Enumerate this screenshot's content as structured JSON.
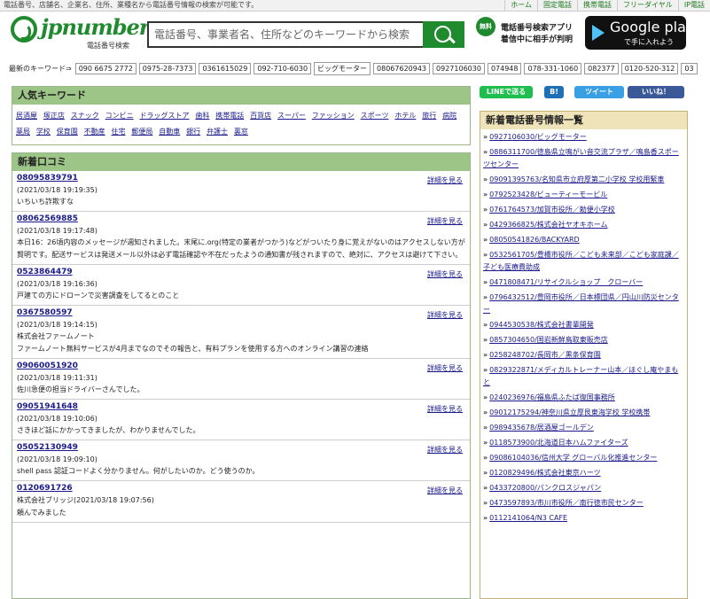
{
  "topbar": {
    "description": "電話番号、店舗名、企業名、住所、業種名から電話番号情報の検索が可能です。",
    "nav": [
      "ホーム",
      "固定電話",
      "携帯電話",
      "フリーダイヤル",
      "IP電話"
    ]
  },
  "header": {
    "logo_text": "jpnumber",
    "logo_sub": "電話番号検索",
    "search_placeholder": "電話番号、事業者名、住所などのキーワードから検索",
    "app_badge": "無料",
    "app_line1": "電話番号検索アプリ",
    "app_line2": "着信中に相手が判明",
    "gplay_line1": "Google play",
    "gplay_line2": "で手に入れよう"
  },
  "keywords": {
    "label": "最新のキーワード⇒",
    "items": [
      "090 6675 2772",
      "0975-28-7373",
      "0361615029",
      "092-710-6030",
      "ビッグモーター",
      "08067620943",
      "0927106030",
      "074948",
      "078-331-1060",
      "082377",
      "0120-520-312",
      "03"
    ]
  },
  "popular": {
    "title": "人気キーワード",
    "tags": [
      "居酒屋",
      "塚正店",
      "スナック",
      "コンビニ",
      "ドラッグストア",
      "歯科",
      "携帯電話",
      "百貨店",
      "スーパー",
      "ファッション",
      "スポーツ",
      "ホテル",
      "旅行",
      "病院",
      "薬局",
      "学校",
      "保育園",
      "不動産",
      "住宅",
      "郵便局",
      "自動車",
      "銀行",
      "弁護士",
      "裏窓"
    ]
  },
  "social": {
    "line": "LINEで送る",
    "hatena": "B!",
    "tweet": "ツイート",
    "like": "いいね！"
  },
  "reviews": {
    "title": "新着口コミ",
    "more_label": "詳細を見る",
    "items": [
      {
        "number": "08095839791",
        "date": "(2021/03/18 19:19:35)",
        "body": [
          "いちいち詐欺すな"
        ]
      },
      {
        "number": "08062569885",
        "date": "(2021/03/18 19:17:48)",
        "body": [
          "本日16：26頃内容のメッセージが週知されました。末尾に.org(特定の業者がつかう)などがついたり身に覚えがないのはアクセスしない方が賢明です。配送サービスは発送メール以外は必ず電話確認や不在だったようの通知書が残されますので、絶対に、アクセスは避けて下さい。"
        ]
      },
      {
        "number": "0523864479",
        "date": "(2021/03/18 19:16:36)",
        "body": [
          "戸建ての方にドローンで災害調査をしてるとのこと"
        ]
      },
      {
        "number": "0367580597",
        "date": "(2021/03/18 19:14:15)",
        "body": [
          "株式会社ファームノート",
          "ファームノート無料サービスが4月までなのでその報告と、有料プランを使用する方へのオンライン講習の連絡"
        ]
      },
      {
        "number": "09060051920",
        "date": "(2021/03/18 19:11:31)",
        "body": [
          "佐川急便の担当ドライバーさんでした。"
        ]
      },
      {
        "number": "09051941648",
        "date": "(2021/03/18 19:10:06)",
        "body": [
          "さきほど話にかかってきましたが、わかりませんでした。"
        ]
      },
      {
        "number": "05052130949",
        "date": "(2021/03/18 19:09:10)",
        "body": [
          "shell pass 認証コードよく分かりません。何がしたいのか。どう使うのか。"
        ]
      },
      {
        "number": "0120691726",
        "date": "",
        "body": [
          "株式会社ブリッジ(2021/03/18 19:07:56)",
          "頼んでみました"
        ]
      }
    ]
  },
  "newlist": {
    "title": "新着電話番号情報一覧",
    "items": [
      "0927106030/ビッグモーター",
      "0886311700/徳島県立鳴がい音交流プラザ／鳴島香スポーツセンター",
      "09091395763/名知県市立府厚第二小学校 学校用緊車",
      "0792523428/ビューティーモービル",
      "0761764573/加賀市役所／勅便小学校",
      "0429366825/株式会社ヤオキホーム",
      "08050541826/BACKYARD",
      "0532561705/豊橋市役所／こども未来部／こども家庭課／子ども医療費助成",
      "0471808471/リサイクルショップ　クローバー",
      "0796432512/豊岡市役所／日本標団県／円山川防災センター",
      "0944530538/株式会社書輩開発",
      "0857304650/国岩新鮮鳥取東販売店",
      "0258248702/長岡市／黒条保育園",
      "0829322871/メディカルトレーナー山本／ほぐし庵やまもと",
      "0240236976/福島県ふたば復国事務所",
      "09012175294/神奈川県立厚艮東海学校 学校携帯",
      "0989435678/居酒屋ゴールデン",
      "0118573900/北海道日本ハムファイターズ",
      "09086104036/信州大学 グローバル化推進センター",
      "0120829496/株式会社東京ハーツ",
      "0433720800/パンクロスジャパン",
      "0473597893/市川市役所／南行徳市民センター",
      "0112141064/N3 CAFE"
    ]
  },
  "colors": {
    "brand_green": "#1f8a2e",
    "panel_green": "#9cc587",
    "panel_tan": "#efe3b9",
    "link": "#1a1a8c"
  }
}
